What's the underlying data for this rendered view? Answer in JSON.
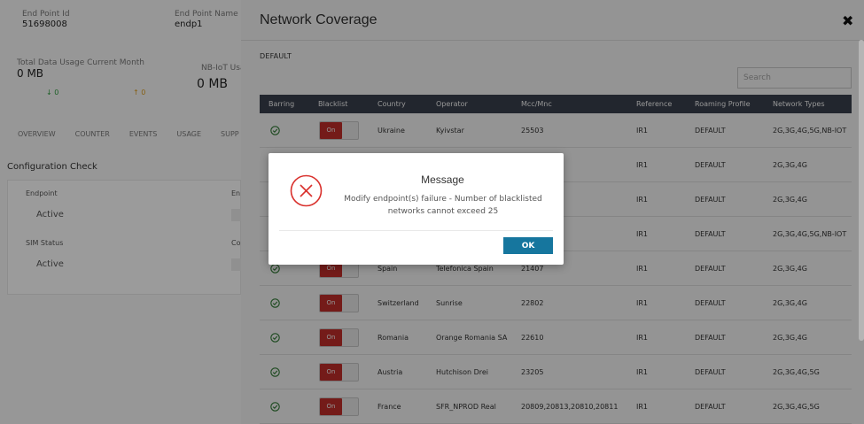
{
  "background": {
    "endpoint_id_label": "End Point Id",
    "endpoint_id_value": "51698008",
    "endpoint_name_label": "End Point Name",
    "endpoint_name_value": "endp1",
    "usage_label": "Total Data Usage Current Month",
    "usage_value": "0 MB",
    "usage_down": "0",
    "usage_up": "0",
    "nbiot_label": "NB-IoT Usa",
    "nbiot_value": "0 MB",
    "tabs": [
      "OVERVIEW",
      "COUNTER",
      "EVENTS",
      "USAGE",
      "SUPP"
    ],
    "config_title": "Configuration Check",
    "endpoint_label": "Endpoint",
    "endpoint_status": "Active",
    "sim_label": "SIM Status",
    "sim_status": "Active",
    "en_label": "En",
    "co_label": "Co"
  },
  "panel": {
    "title": "Network Coverage",
    "close_glyph": "✖",
    "profile": "DEFAULT",
    "search_placeholder": "Search",
    "columns": [
      "Barring",
      "Blacklist",
      "Country",
      "Operator",
      "Mcc/Mnc",
      "Reference",
      "Roaming Profile",
      "Network Types"
    ],
    "rows": [
      {
        "blacklist": "On",
        "country": "Ukraine",
        "operator": "Kyivstar",
        "mccmnc": "25503",
        "reference": "IR1",
        "profile": "DEFAULT",
        "types": "2G,3G,4G,5G,NB-IOT"
      },
      {
        "blacklist": "On",
        "country": "",
        "operator": "",
        "mccmnc": "",
        "reference": "IR1",
        "profile": "DEFAULT",
        "types": "2G,3G,4G"
      },
      {
        "blacklist": "On",
        "country": "",
        "operator": "",
        "mccmnc": "",
        "reference": "IR1",
        "profile": "DEFAULT",
        "types": "2G,3G,4G"
      },
      {
        "blacklist": "On",
        "country": "",
        "operator": "",
        "mccmnc": "",
        "reference": "IR1",
        "profile": "DEFAULT",
        "types": "2G,3G,4G,5G,NB-IOT"
      },
      {
        "blacklist": "On",
        "country": "Spain",
        "operator": "Telefonica Spain",
        "mccmnc": "21407",
        "reference": "IR1",
        "profile": "DEFAULT",
        "types": "2G,3G,4G"
      },
      {
        "blacklist": "On",
        "country": "Switzerland",
        "operator": "Sunrise",
        "mccmnc": "22802",
        "reference": "IR1",
        "profile": "DEFAULT",
        "types": "2G,3G,4G"
      },
      {
        "blacklist": "On",
        "country": "Romania",
        "operator": "Orange Romania SA",
        "mccmnc": "22610",
        "reference": "IR1",
        "profile": "DEFAULT",
        "types": "2G,3G,4G"
      },
      {
        "blacklist": "On",
        "country": "Austria",
        "operator": "Hutchison Drei",
        "mccmnc": "23205",
        "reference": "IR1",
        "profile": "DEFAULT",
        "types": "2G,3G,4G,5G"
      },
      {
        "blacklist": "On",
        "country": "France",
        "operator": "SFR_NPROD Real",
        "mccmnc": "20809,20813,20810,20811",
        "reference": "IR1",
        "profile": "DEFAULT",
        "types": "2G,3G,4G,5G"
      }
    ]
  },
  "dialog": {
    "title": "Message",
    "message": "Modify endpoint(s) failure - Number of blacklisted networks cannot exceed 25",
    "ok_label": "OK"
  },
  "colors": {
    "header_bg": "#3c4350",
    "toggle_on": "#c9302c",
    "ok_button": "#16769e",
    "error_icon": "#d9302c",
    "check_icon": "#2e7d32",
    "arrow_down": "#2e9a3e",
    "arrow_up": "#d99a1e"
  }
}
